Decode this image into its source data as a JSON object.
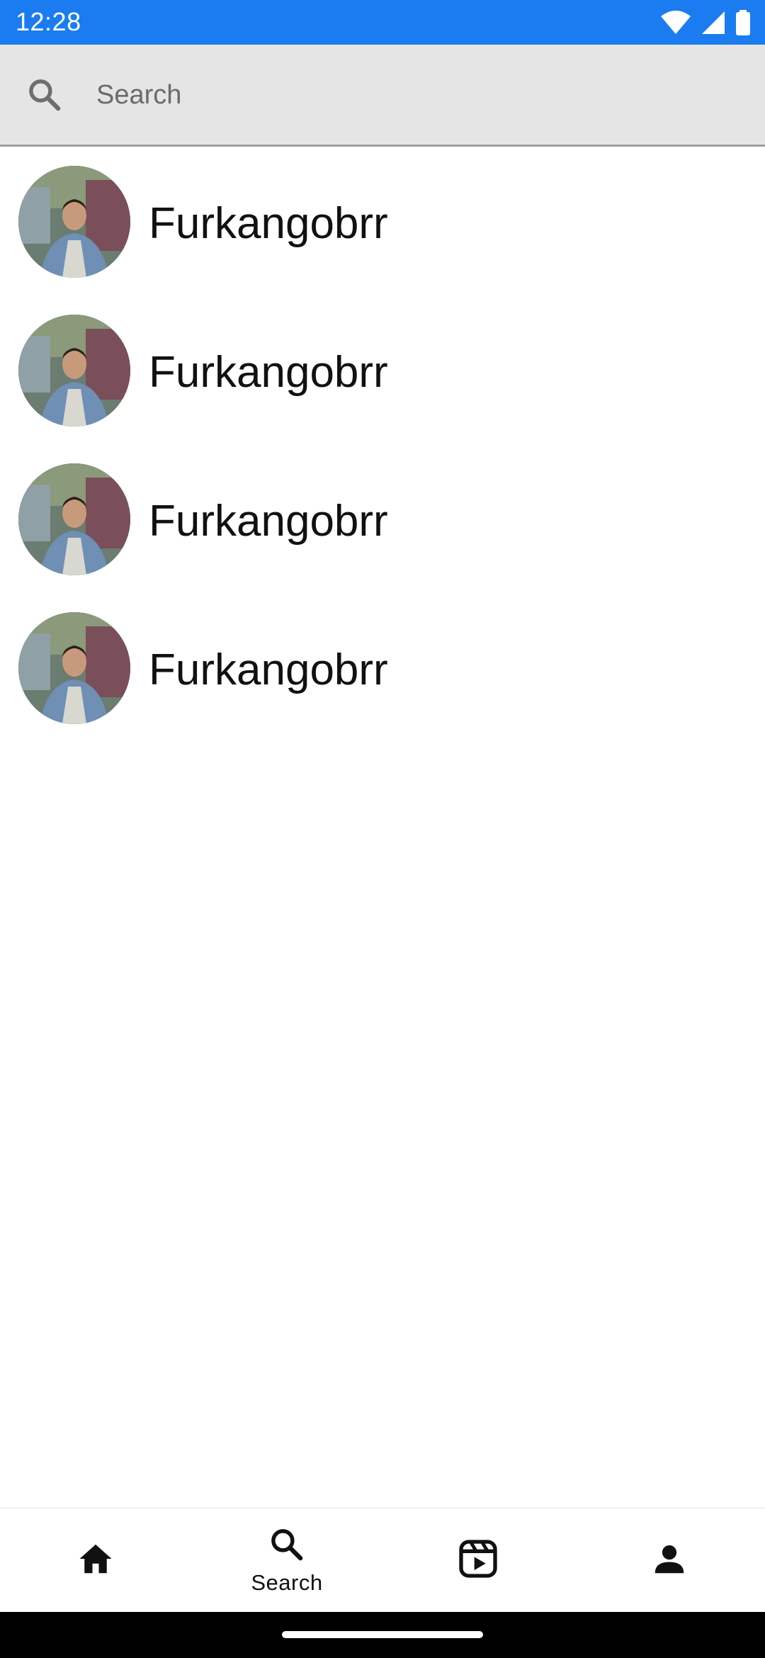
{
  "status_bar": {
    "time": "12:28",
    "background": "#1a7cf0",
    "icons": [
      "wifi-icon",
      "signal-icon",
      "battery-icon"
    ]
  },
  "search": {
    "placeholder": "Search",
    "value": "",
    "icon": "search-icon"
  },
  "users": [
    {
      "name": "Furkangobrr"
    },
    {
      "name": "Furkangobrr"
    },
    {
      "name": "Furkangobrr"
    },
    {
      "name": "Furkangobrr"
    }
  ],
  "bottom_nav": {
    "items": [
      {
        "icon": "home-icon",
        "label": ""
      },
      {
        "icon": "search-icon",
        "label": "Search",
        "selected": true
      },
      {
        "icon": "reels-icon",
        "label": ""
      },
      {
        "icon": "profile-icon",
        "label": ""
      }
    ]
  }
}
